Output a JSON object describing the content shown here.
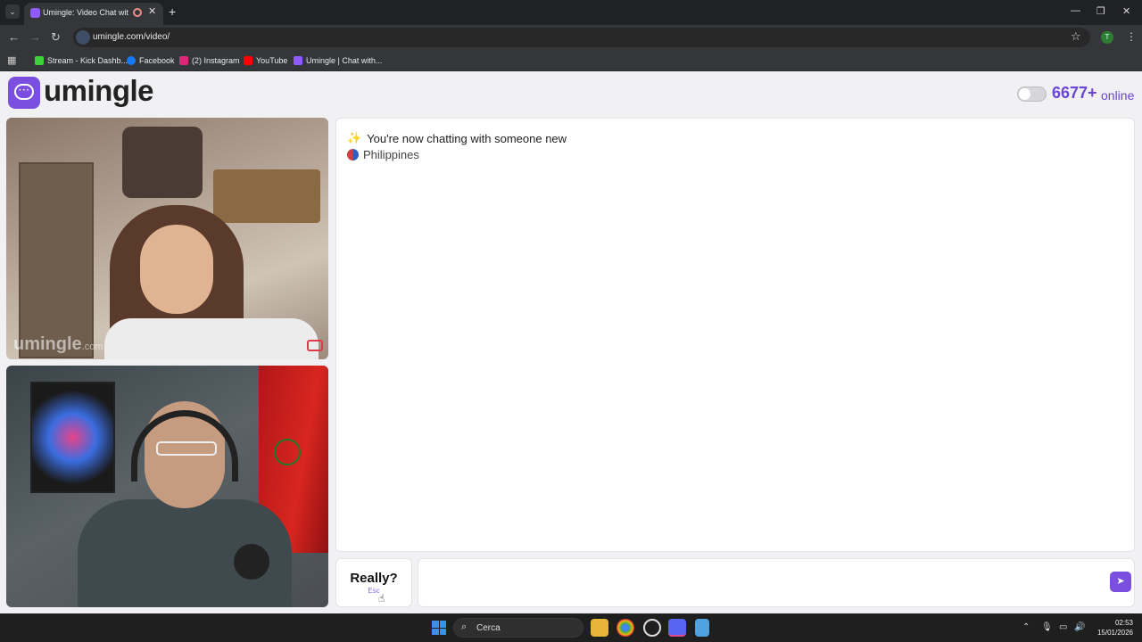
{
  "browser": {
    "tab_title": "Umingle: Video Chat with S",
    "url": "umingle.com/video/",
    "profile_initial": "T",
    "bookmarks": [
      {
        "label": "Stream - Kick Dashb...",
        "color": "#3cd13c"
      },
      {
        "label": "Facebook",
        "color": "#1877f2"
      },
      {
        "label": "(2) Instagram",
        "color": "#d62976"
      },
      {
        "label": "YouTube",
        "color": "#ff0000"
      },
      {
        "label": "Umingle | Chat with...",
        "color": "#8f5bff"
      }
    ]
  },
  "header": {
    "logo_text": "umingle",
    "online_count": "6677+",
    "online_label": "online",
    "accent_color": "#6a45d8"
  },
  "video": {
    "watermark": "umingle",
    "watermark_suffix": ".com"
  },
  "chat": {
    "status_message": "You're now chatting with someone new",
    "partner_country": "Philippines"
  },
  "controls": {
    "skip_label": "Really?",
    "skip_hint": "Esc",
    "message_placeholder": ""
  },
  "taskbar": {
    "search_label": "Cerca",
    "time": "02:53",
    "date": "15/01/2026"
  }
}
